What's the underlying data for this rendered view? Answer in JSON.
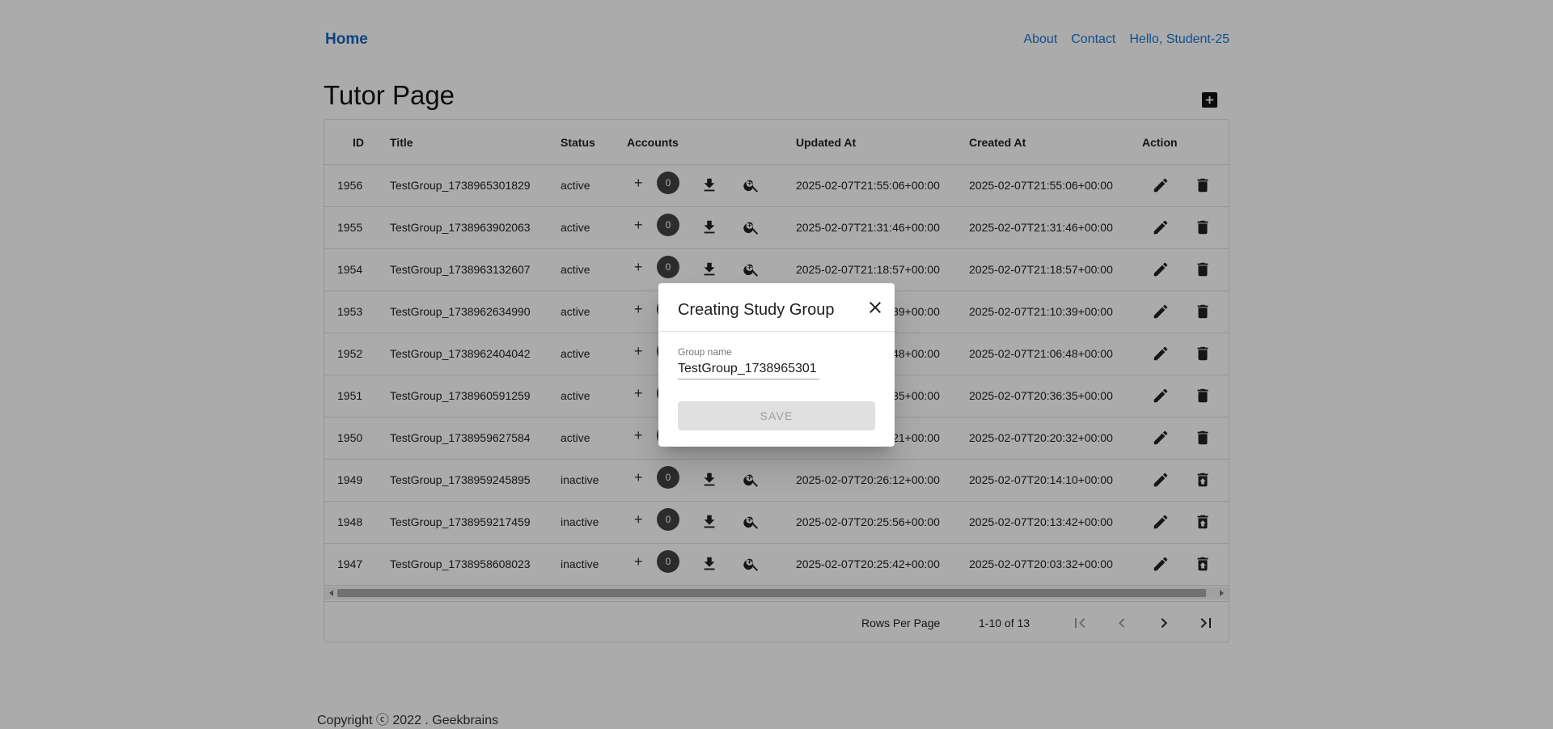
{
  "nav": {
    "home": "Home",
    "links": [
      "About",
      "Contact",
      "Hello, Student-25"
    ]
  },
  "page": {
    "title": "Tutor Page"
  },
  "table": {
    "columns": [
      "ID",
      "Title",
      "Status",
      "Accounts",
      "Updated At",
      "Created At",
      "Action"
    ],
    "rows": [
      {
        "id": "1956",
        "title": "TestGroup_1738965301829",
        "status": "active",
        "accounts": "0",
        "updated": "2025-02-07T21:55:06+00:00",
        "created": "2025-02-07T21:55:06+00:00"
      },
      {
        "id": "1955",
        "title": "TestGroup_1738963902063",
        "status": "active",
        "accounts": "0",
        "updated": "2025-02-07T21:31:46+00:00",
        "created": "2025-02-07T21:31:46+00:00"
      },
      {
        "id": "1954",
        "title": "TestGroup_1738963132607",
        "status": "active",
        "accounts": "0",
        "updated": "2025-02-07T21:18:57+00:00",
        "created": "2025-02-07T21:18:57+00:00"
      },
      {
        "id": "1953",
        "title": "TestGroup_1738962634990",
        "status": "active",
        "accounts": "0",
        "updated": "2025-02-07T21:10:39+00:00",
        "created": "2025-02-07T21:10:39+00:00"
      },
      {
        "id": "1952",
        "title": "TestGroup_1738962404042",
        "status": "active",
        "accounts": "0",
        "updated": "2025-02-07T21:06:48+00:00",
        "created": "2025-02-07T21:06:48+00:00"
      },
      {
        "id": "1951",
        "title": "TestGroup_1738960591259",
        "status": "active",
        "accounts": "0",
        "updated": "2025-02-07T20:36:35+00:00",
        "created": "2025-02-07T20:36:35+00:00"
      },
      {
        "id": "1950",
        "title": "TestGroup_1738959627584",
        "status": "active",
        "accounts": "0",
        "updated": "2025-02-07T20:32:21+00:00",
        "created": "2025-02-07T20:20:32+00:00"
      },
      {
        "id": "1949",
        "title": "TestGroup_1738959245895",
        "status": "inactive",
        "accounts": "0",
        "updated": "2025-02-07T20:26:12+00:00",
        "created": "2025-02-07T20:14:10+00:00"
      },
      {
        "id": "1948",
        "title": "TestGroup_1738959217459",
        "status": "inactive",
        "accounts": "0",
        "updated": "2025-02-07T20:25:56+00:00",
        "created": "2025-02-07T20:13:42+00:00"
      },
      {
        "id": "1947",
        "title": "TestGroup_1738958608023",
        "status": "inactive",
        "accounts": "0",
        "updated": "2025-02-07T20:25:42+00:00",
        "created": "2025-02-07T20:03:32+00:00"
      }
    ]
  },
  "pagination": {
    "rows_per_page_label": "Rows Per Page",
    "range": "1-10 of 13"
  },
  "footer": {
    "copyright": "Copyright ⓒ 2022 . Geekbrains"
  },
  "dialog": {
    "title": "Creating Study Group",
    "field_label": "Group name",
    "field_value": "TestGroup_1738965301",
    "save_label": "SAVE"
  },
  "icons": {
    "add": "add-box-icon",
    "close": "close-icon",
    "download": "download-icon",
    "search": "zoom-in-icon",
    "edit": "pencil-icon",
    "delete": "trash-icon",
    "restore": "restore-from-trash-icon",
    "first": "first-page-icon",
    "prev": "chevron-left-icon",
    "next": "chevron-right-icon",
    "last": "last-page-icon"
  },
  "colors": {
    "link": "#1976d2",
    "overlay": "rgba(0,0,0,0.33)",
    "badge": "#424242"
  }
}
